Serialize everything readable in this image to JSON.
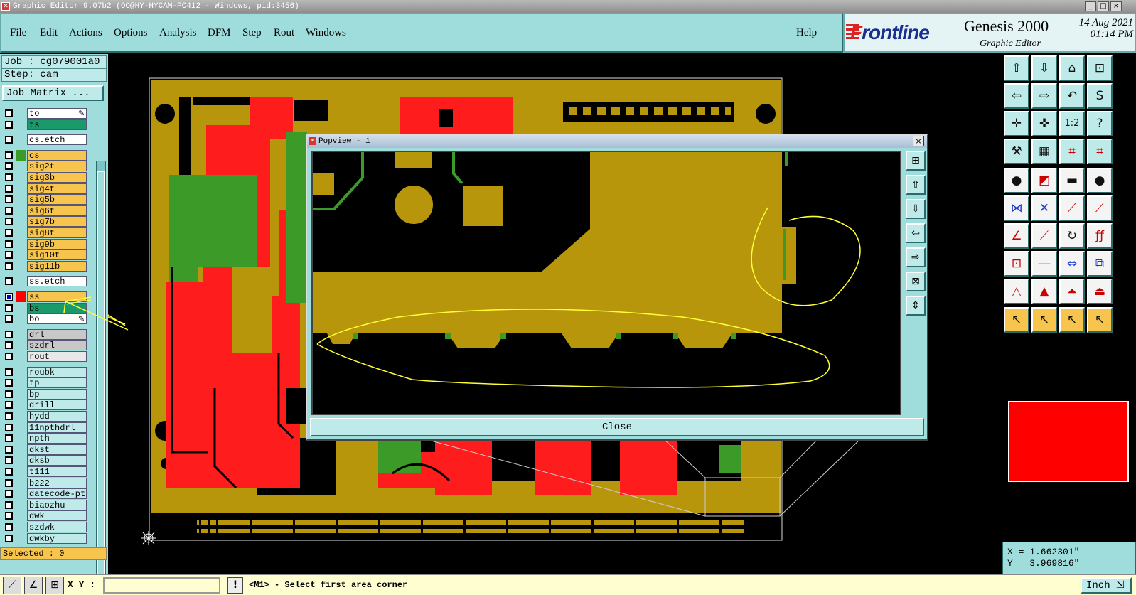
{
  "window": {
    "title": "Graphic Editor 9.07b2 (OO@HY-HYCAM-PC412 - Windows, pid:3456)",
    "controls": [
      "_",
      "□",
      "×"
    ]
  },
  "menu": {
    "items": [
      "File",
      "Edit",
      "Actions",
      "Options",
      "Analysis",
      "DFM",
      "Step",
      "Rout",
      "Windows"
    ],
    "help": "Help"
  },
  "brand": {
    "logo_prefix": "F",
    "logo_rest": "rontline",
    "product": "Genesis 2000",
    "subtitle": "Graphic Editor",
    "date": "14 Aug 2021",
    "time": "01:14 PM"
  },
  "job": {
    "job_label": "Job : cg079001a0",
    "step_label": "Step: cam",
    "matrix_button": "Job Matrix ..."
  },
  "layers": [
    {
      "name": "to",
      "color": "#ffffff",
      "state": "box",
      "pen": true
    },
    {
      "name": "ts",
      "color": "#1a9a6a",
      "state": "box"
    },
    {
      "name": "cs.etch",
      "color": "#ffffff",
      "state": "box"
    },
    {
      "name": "cs",
      "color": "#f7c44d",
      "state": "box",
      "swatch": "#3c9a28"
    },
    {
      "name": "sig2t",
      "color": "#f7c44d",
      "state": "box"
    },
    {
      "name": "sig3b",
      "color": "#f7c44d",
      "state": "box"
    },
    {
      "name": "sig4t",
      "color": "#f7c44d",
      "state": "box"
    },
    {
      "name": "sig5b",
      "color": "#f7c44d",
      "state": "box"
    },
    {
      "name": "sig6t",
      "color": "#f7c44d",
      "state": "box"
    },
    {
      "name": "sig7b",
      "color": "#f7c44d",
      "state": "box"
    },
    {
      "name": "sig8t",
      "color": "#f7c44d",
      "state": "box"
    },
    {
      "name": "sig9b",
      "color": "#f7c44d",
      "state": "box"
    },
    {
      "name": "sig10t",
      "color": "#f7c44d",
      "state": "box"
    },
    {
      "name": "sig11b",
      "color": "#f7c44d",
      "state": "box"
    },
    {
      "name": "ss.etch",
      "color": "#ffffff",
      "state": "box"
    },
    {
      "name": "ss",
      "color": "#f7c44d",
      "state": "on",
      "swatch": "#ff0000"
    },
    {
      "name": "bs",
      "color": "#1a9a6a",
      "state": "box"
    },
    {
      "name": "bo",
      "color": "#ffffff",
      "state": "box",
      "pen": true
    },
    {
      "name": "drl",
      "color": "#c8c8c8",
      "state": "box"
    },
    {
      "name": "szdrl",
      "color": "#c8c8c8",
      "state": "box"
    },
    {
      "name": "rout",
      "color": "#e8e8e8",
      "state": "box"
    },
    {
      "name": "roubk",
      "color": "#bfeaea",
      "state": "box"
    },
    {
      "name": "tp",
      "color": "#bfeaea",
      "state": "box"
    },
    {
      "name": "bp",
      "color": "#bfeaea",
      "state": "box"
    },
    {
      "name": "drill",
      "color": "#bfeaea",
      "state": "box"
    },
    {
      "name": "hydd",
      "color": "#bfeaea",
      "state": "box"
    },
    {
      "name": "11npthdrl",
      "color": "#bfeaea",
      "state": "box"
    },
    {
      "name": "npth",
      "color": "#bfeaea",
      "state": "box"
    },
    {
      "name": "dkst",
      "color": "#bfeaea",
      "state": "box"
    },
    {
      "name": "dksb",
      "color": "#bfeaea",
      "state": "box"
    },
    {
      "name": "t111",
      "color": "#bfeaea",
      "state": "box"
    },
    {
      "name": "b222",
      "color": "#bfeaea",
      "state": "box"
    },
    {
      "name": "datecode-pto",
      "color": "#bfeaea",
      "state": "box"
    },
    {
      "name": "biaozhu",
      "color": "#bfeaea",
      "state": "box"
    },
    {
      "name": "dwk",
      "color": "#bfeaea",
      "state": "box"
    },
    {
      "name": "szdwk",
      "color": "#bfeaea",
      "state": "box"
    },
    {
      "name": "dwkby",
      "color": "#bfeaea",
      "state": "box"
    }
  ],
  "selected_label": "Selected : 0",
  "popview": {
    "title": "Popview - 1",
    "close_button": "Close",
    "close_icon": "×"
  },
  "coords": {
    "x": "X =  1.662301\"",
    "y": "Y =  3.969816\""
  },
  "status": {
    "xy_label": "X Y :",
    "xy_value": "",
    "message": "<M1> - Select first area corner",
    "warn": "!",
    "units": "Inch"
  },
  "colors": {
    "copper": "#b8960c",
    "trace_red": "#ff1c1c",
    "green": "#3c9a28",
    "panel": "#9fdcdc",
    "annotation": "#ffff33"
  }
}
